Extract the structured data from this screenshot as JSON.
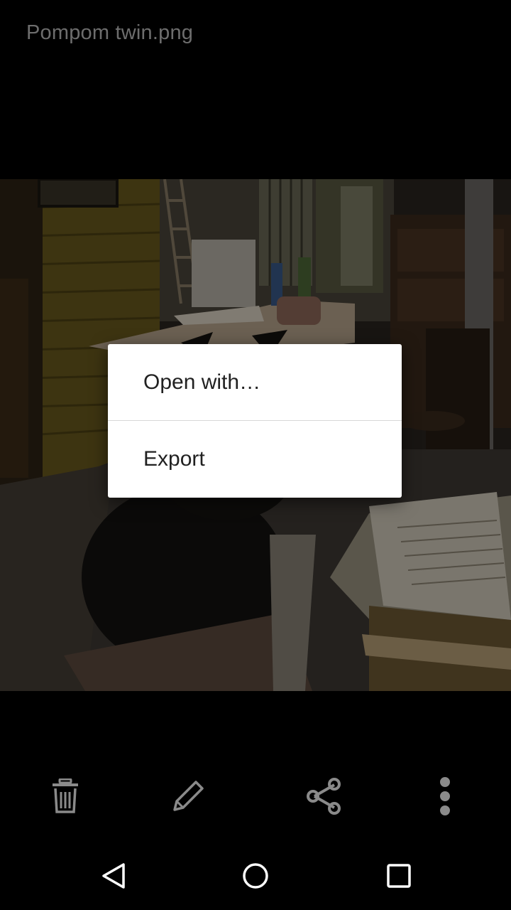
{
  "header": {
    "file_name": "Pompom twin.png"
  },
  "photo": {
    "description_icon": "photo-cat-workshop"
  },
  "dialog": {
    "items": [
      {
        "label": "Open with…"
      },
      {
        "label": "Export"
      }
    ]
  },
  "toolbar": {
    "icons": [
      "trash-icon",
      "edit-pencil-icon",
      "share-icon",
      "more-vert-icon"
    ]
  },
  "navbar": {
    "icons": [
      "back-triangle-icon",
      "home-circle-icon",
      "recents-square-icon"
    ]
  },
  "colors": {
    "background": "#000000",
    "title_text": "#6d6d6d",
    "dialog_bg": "#ffffff",
    "dialog_text": "#212121",
    "icon_gray": "#8a8a8a"
  }
}
